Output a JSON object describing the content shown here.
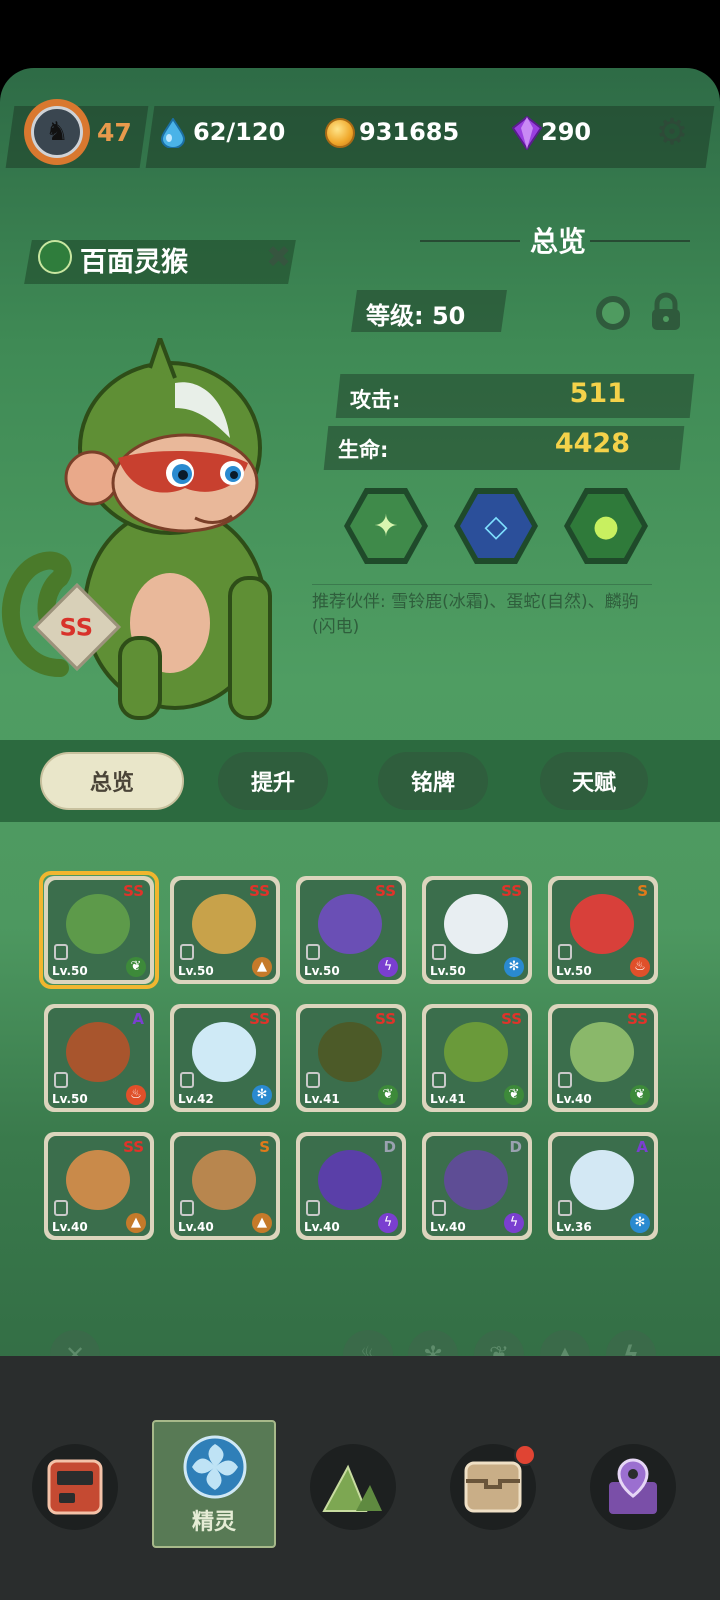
{
  "header": {
    "player_level": "47",
    "stamina": "62/120",
    "coins": "931685",
    "gems": "290",
    "settings_icon": "gear-icon"
  },
  "pet": {
    "name": "百面灵猴",
    "rank": "SS",
    "section_title": "总览",
    "level_text": "等级: 50",
    "attack_label": "攻击:",
    "attack_value": "511",
    "hp_label": "生命:",
    "hp_value": "4428",
    "recommend": "推荐伙伴: 雪铃鹿(冰霜)、蛋蛇(自然)、麟驹(闪电)"
  },
  "skills": [
    "wind-blade-icon",
    "frost-frame-icon",
    "orb-icon"
  ],
  "tabs": [
    "总览",
    "提升",
    "铭牌",
    "天赋"
  ],
  "active_tab": 0,
  "roster": [
    {
      "rank": "SS",
      "lv": "Lv.50",
      "element": "nature",
      "color": "#5d9a4a"
    },
    {
      "rank": "SS",
      "lv": "Lv.50",
      "element": "earth",
      "color": "#c8a24a"
    },
    {
      "rank": "SS",
      "lv": "Lv.50",
      "element": "electric",
      "color": "#6a4fb5"
    },
    {
      "rank": "SS",
      "lv": "Lv.50",
      "element": "ice",
      "color": "#e8eef2"
    },
    {
      "rank": "S",
      "lv": "Lv.50",
      "element": "fire",
      "color": "#d8403a"
    },
    {
      "rank": "A",
      "lv": "Lv.50",
      "element": "fire",
      "color": "#a8552d"
    },
    {
      "rank": "SS",
      "lv": "Lv.42",
      "element": "ice",
      "color": "#cfeaf6"
    },
    {
      "rank": "SS",
      "lv": "Lv.41",
      "element": "nature",
      "color": "#4c5a28"
    },
    {
      "rank": "SS",
      "lv": "Lv.41",
      "element": "nature",
      "color": "#6a9a3a"
    },
    {
      "rank": "SS",
      "lv": "Lv.40",
      "element": "nature",
      "color": "#8ab86a"
    },
    {
      "rank": "SS",
      "lv": "Lv.40",
      "element": "earth",
      "color": "#c98a4a"
    },
    {
      "rank": "S",
      "lv": "Lv.40",
      "element": "earth",
      "color": "#b8864e"
    },
    {
      "rank": "D",
      "lv": "Lv.40",
      "element": "electric",
      "color": "#5a3fa8"
    },
    {
      "rank": "D",
      "lv": "Lv.40",
      "element": "electric",
      "color": "#5e4d95"
    },
    {
      "rank": "A",
      "lv": "Lv.36",
      "element": "ice",
      "color": "#d3e8f4"
    }
  ],
  "filters": [
    "close-filter-icon",
    "fire-filter-icon",
    "ice-filter-icon",
    "nature-filter-icon",
    "earth-filter-icon",
    "electric-filter-icon"
  ],
  "nav": {
    "active_label": "精灵",
    "items": [
      "device-icon",
      "pet-icon",
      "mountain-icon",
      "chest-icon",
      "map-pin-icon"
    ]
  },
  "colors": {
    "accent": "#f4d24a",
    "rank_red": "#e0332a",
    "selected": "#f1b62f"
  }
}
